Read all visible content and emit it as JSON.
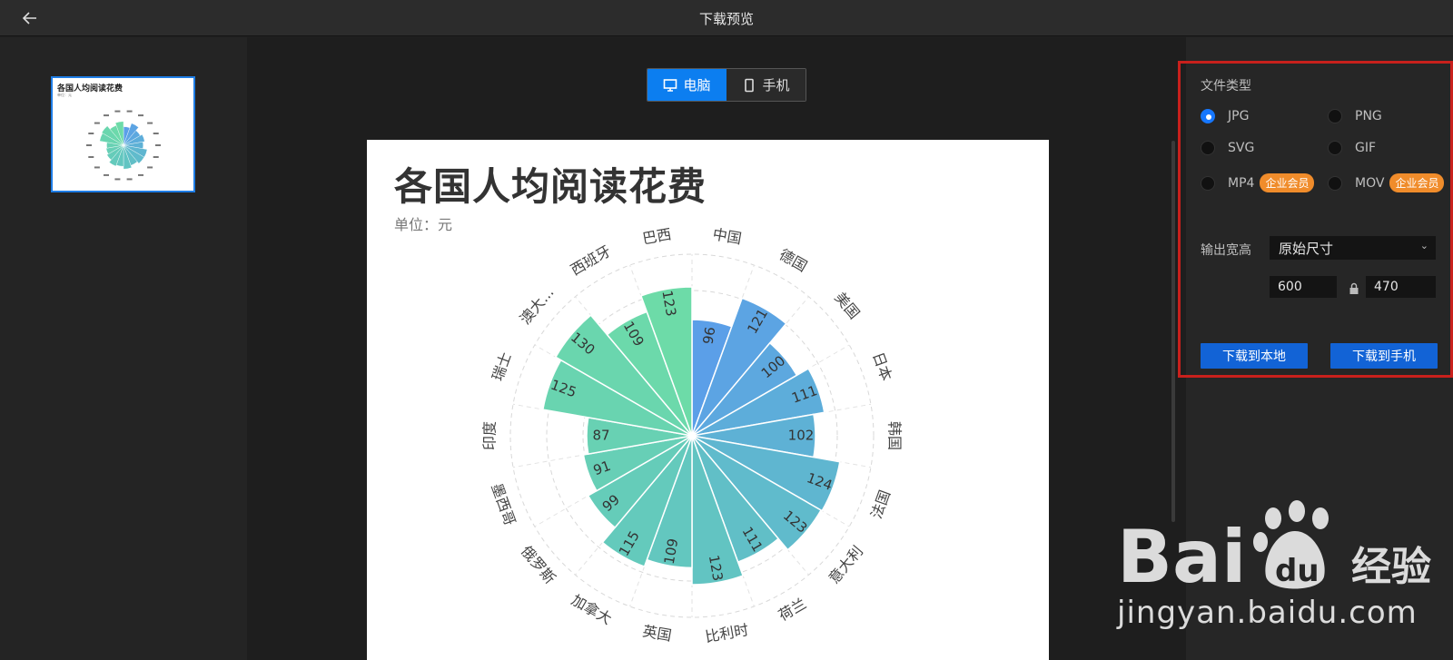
{
  "header": {
    "title": "下载预览"
  },
  "thumbnail": {
    "title": "各国人均阅读花费",
    "subtitle": "单位：元"
  },
  "toggle": {
    "pc_label": "电脑",
    "mobile_label": "手机"
  },
  "chart": {
    "title": "各国人均阅读花费",
    "unit": "单位：元"
  },
  "chart_data": {
    "type": "polar-bar",
    "title": "各国人均阅读花费",
    "subtitle": "单位：元",
    "categories": [
      "中国",
      "德国",
      "美国",
      "日本",
      "韩国",
      "法国",
      "意大利",
      "荷兰",
      "比利时",
      "英国",
      "加拿大",
      "俄罗斯",
      "墨西哥",
      "印度",
      "瑞士",
      "澳大...",
      "西班牙",
      "巴西"
    ],
    "values": [
      96,
      121,
      100,
      111,
      102,
      124,
      123,
      111,
      123,
      109,
      115,
      99,
      91,
      87,
      125,
      130,
      109,
      123
    ],
    "rlim": [
      0,
      150
    ],
    "colors": [
      "#5b9fe8",
      "#62c6c0",
      "#6ddba8"
    ]
  },
  "settings": {
    "file_type_label": "文件类型",
    "types": [
      {
        "label": "JPG",
        "selected": true
      },
      {
        "label": "PNG",
        "selected": false
      },
      {
        "label": "SVG",
        "selected": false
      },
      {
        "label": "GIF",
        "selected": false
      },
      {
        "label": "MP4",
        "selected": false,
        "badge": "企业会员"
      },
      {
        "label": "MOV",
        "selected": false,
        "badge": "企业会员"
      }
    ],
    "size_label": "输出宽高",
    "size_select": "原始尺寸",
    "width": "600",
    "height": "470",
    "download_local": "下载到本地",
    "download_mobile": "下载到手机"
  },
  "watermark": {
    "text": "jingyan.baidu.com",
    "brand": "Bai du 经验"
  }
}
